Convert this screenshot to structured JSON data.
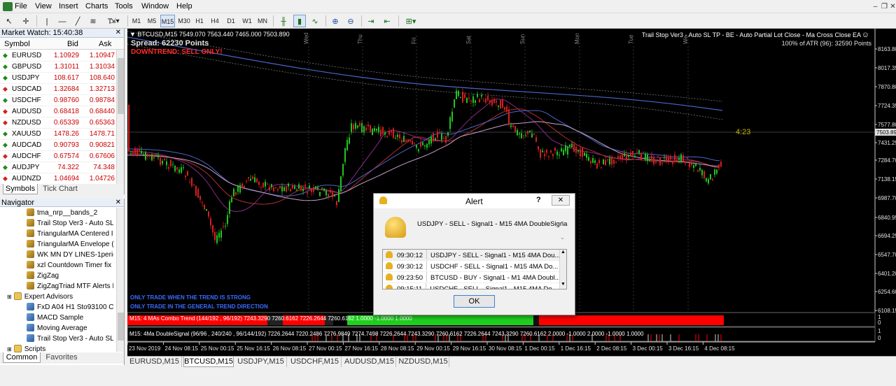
{
  "menu": [
    "File",
    "View",
    "Insert",
    "Charts",
    "Tools",
    "Window",
    "Help"
  ],
  "toolbar": {
    "timeframes": [
      "M1",
      "M5",
      "M15",
      "M30",
      "H1",
      "H4",
      "D1",
      "W1",
      "MN"
    ],
    "selected": "M15"
  },
  "market_watch": {
    "title": "Market Watch: 15:40:38",
    "cols": {
      "symbol": "Symbol",
      "bid": "Bid",
      "ask": "Ask"
    },
    "rows": [
      {
        "symbol": "EURUSD",
        "bid": "1.10929",
        "ask": "1.10947",
        "dir": "up"
      },
      {
        "symbol": "GBPUSD",
        "bid": "1.31011",
        "ask": "1.31034",
        "dir": "up"
      },
      {
        "symbol": "USDJPY",
        "bid": "108.617",
        "ask": "108.640",
        "dir": "up"
      },
      {
        "symbol": "USDCAD",
        "bid": "1.32684",
        "ask": "1.32713",
        "dir": "down"
      },
      {
        "symbol": "USDCHF",
        "bid": "0.98760",
        "ask": "0.98784",
        "dir": "up"
      },
      {
        "symbol": "AUDUSD",
        "bid": "0.68418",
        "ask": "0.68440",
        "dir": "down"
      },
      {
        "symbol": "NZDUSD",
        "bid": "0.65339",
        "ask": "0.65363",
        "dir": "down"
      },
      {
        "symbol": "XAUUSD",
        "bid": "1478.26",
        "ask": "1478.71",
        "dir": "up"
      },
      {
        "symbol": "AUDCAD",
        "bid": "0.90793",
        "ask": "0.90821",
        "dir": "up"
      },
      {
        "symbol": "AUDCHF",
        "bid": "0.67574",
        "ask": "0.67606",
        "dir": "down"
      },
      {
        "symbol": "AUDJPY",
        "bid": "74.322",
        "ask": "74.348",
        "dir": "up"
      },
      {
        "symbol": "AUDNZD",
        "bid": "1.04694",
        "ask": "1.04726",
        "dir": "down"
      }
    ],
    "tabs": [
      "Symbols",
      "Tick Chart"
    ]
  },
  "navigator": {
    "title": "Navigator",
    "items": [
      {
        "label": "tma_nrp__bands_2",
        "kind": "ind",
        "level": 2
      },
      {
        "label": "Trail Stop Ver3 - Auto SL",
        "kind": "ind",
        "level": 2
      },
      {
        "label": "TriangularMA Centered I",
        "kind": "ind",
        "level": 2
      },
      {
        "label": "TriangularMA Envelope (",
        "kind": "ind",
        "level": 2
      },
      {
        "label": "WK MN DY LINES-1perio",
        "kind": "ind",
        "level": 2
      },
      {
        "label": "xzl Countdown Timer fix",
        "kind": "ind",
        "level": 2
      },
      {
        "label": "ZigZag",
        "kind": "ind",
        "level": 2
      },
      {
        "label": "ZigZagTriad MTF Alerts I",
        "kind": "ind",
        "level": 2
      },
      {
        "label": "Expert Advisors",
        "kind": "fold",
        "level": 1
      },
      {
        "label": "FxD A04 H1 Sto93100 Cro",
        "kind": "ea",
        "level": 2
      },
      {
        "label": "MACD Sample",
        "kind": "ea",
        "level": 2
      },
      {
        "label": "Moving Average",
        "kind": "ea",
        "level": 2
      },
      {
        "label": "Trail Stop Ver3 - Auto SL",
        "kind": "ea",
        "level": 2
      },
      {
        "label": "Scripts",
        "kind": "fold",
        "level": 1
      }
    ],
    "tabs": [
      "Common",
      "Favorites"
    ]
  },
  "chart": {
    "header": "BTCUSD,M15  7549.070 7563.440 7465.000 7503.890",
    "spread": "Spread: 62230 Points",
    "trend_label": "DOWNTREND: SELL ONLY!",
    "ea_label": "Trail Stop Ver3 - Auto SL TP - BE - Auto Partial Lot Close - Ma Cross Close EA",
    "atr_label": "100% of ATR (96): 32590 Points",
    "countdown": "4:23",
    "hint1": "ONLY TRADE WHEN THE TREND IS STRONG",
    "hint2": "ONLY TRADE IN THE GENERAL TREND DIRECTION",
    "day_labels": [
      "Wed",
      "Thu",
      "Fri",
      "Sat",
      "Sun",
      "Mon",
      "Tue",
      "We"
    ],
    "price_ticks": [
      "8163.80",
      "8017.35",
      "7870.80",
      "7724.35",
      "7577.80",
      "7503.89",
      "7431.25",
      "7284.70",
      "7138.15",
      "6987.70",
      "6840.95",
      "6694.25",
      "6547.70",
      "6401.20",
      "6254.60",
      "6108.15"
    ],
    "current_price": "7503.89",
    "indicator1_label": "M15: 4 MAs Combo Trend (144/192 , 96/192)  7243.3290 7260.6162 7226.2644 7260.6162 1.0000 -1.0000 1.0000",
    "indicator2_label": "M15: 4Ma DoubleSignal (96/96 , 240/240 , 96/144/192)  7226.2644 7220.2486 7276.9849 7274.7498 7226.2644 7243.3290 7260.6162 7226.2644 7243.3290 7260.6162 2.0000 -1.0000 2.0000 -1.0000 1.0000",
    "ind_ticks": [
      "1",
      "0",
      "1",
      "0"
    ],
    "time_labels": [
      "23 Nov 2019",
      "24 Nov 08:15",
      "25 Nov 00:15",
      "25 Nov 16:15",
      "26 Nov 08:15",
      "27 Nov 00:15",
      "27 Nov 16:15",
      "28 Nov 08:15",
      "29 Nov 00:15",
      "29 Nov 16:15",
      "30 Nov 08:15",
      "1 Dec 00:15",
      "1 Dec 16:15",
      "2 Dec 08:15",
      "3 Dec 00:15",
      "3 Dec 16:15",
      "4 Dec 08:15"
    ]
  },
  "alert": {
    "title": "Alert",
    "help": "?",
    "message": "USDJPY - SELL  - Signal1  - M15  4MA DoubleSigna",
    "rows": [
      {
        "time": "09:30:12",
        "text": "USDJPY - SELL  - Signal1  - M15  4MA Dou..."
      },
      {
        "time": "09:30:12",
        "text": "USDCHF - SELL  - Signal1  - M15  4MA Do..."
      },
      {
        "time": "09:23:50",
        "text": "BTCUSD - BUY  - Signal1  - M1  4MA Doubl..."
      },
      {
        "time": "09:15:11",
        "text": "USDCHF - SELL  - Signal1  - M15  4MA Do..."
      }
    ],
    "ok": "OK"
  },
  "bottom_tabs": [
    "EURUSD,M15",
    "BTCUSD,M15",
    "USDJPY,M15",
    "USDCHF,M15",
    "AUDUSD,M15",
    "NZDUSD,M15"
  ],
  "active_tab": "BTCUSD,M15",
  "colors": {
    "bull": "#22c522",
    "bear": "#d42020",
    "ma_blue": "#4a66c8",
    "trend_label": "#ff2b2b",
    "hint": "#3a6cff",
    "ind_green": "#1fd01f",
    "ind_red": "#ff0000",
    "price_text": "#e0e0e0",
    "countdown": "#c8b400"
  }
}
